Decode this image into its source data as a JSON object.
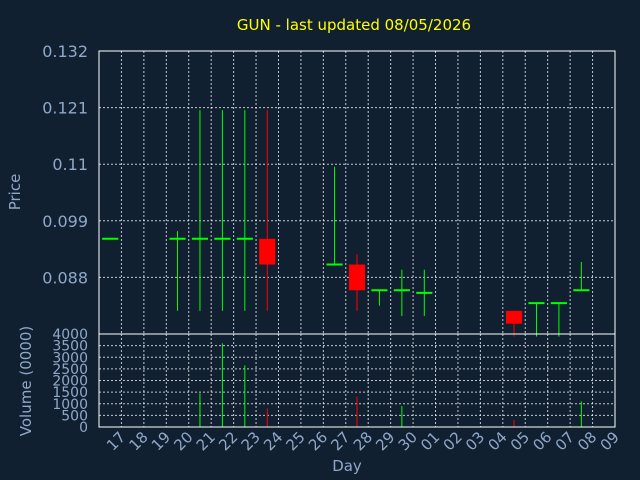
{
  "chart_data": {
    "type": "candlestick",
    "title": "GUN - last updated 08/05/2026",
    "ylabel_price": "Price",
    "ylabel_volume": "Volume (0000)",
    "xlabel": "Day",
    "price_ylim": [
      0.077,
      0.132
    ],
    "price_ticks": [
      "0.132",
      "0.121",
      "0.11",
      "0.099",
      "0.088"
    ],
    "volume_ylim": [
      0,
      4000
    ],
    "volume_ticks": [
      "4000",
      "3500",
      "3000",
      "2500",
      "2000",
      "1500",
      "1000",
      "500",
      "0"
    ],
    "x_ticks": [
      "17",
      "18",
      "19",
      "20",
      "21",
      "22",
      "23",
      "24",
      "25",
      "26",
      "27",
      "28",
      "29",
      "30",
      "01",
      "02",
      "03",
      "04",
      "05",
      "06",
      "07",
      "08",
      "09"
    ],
    "grid": true,
    "colors": {
      "up": "#00ff00",
      "down": "#ff0000",
      "background": "#112031",
      "title": "#ffff00",
      "text": "#8fa8c8"
    },
    "candles": [
      {
        "day": "17",
        "open": 0.0955,
        "high": 0.0955,
        "low": 0.0955,
        "close": 0.0955,
        "volume": 0
      },
      {
        "day": "20",
        "open": 0.0955,
        "high": 0.097,
        "low": 0.0815,
        "close": 0.0955,
        "volume": 0
      },
      {
        "day": "21",
        "open": 0.0955,
        "high": 0.1205,
        "low": 0.0815,
        "close": 0.0955,
        "volume": 1450
      },
      {
        "day": "22",
        "open": 0.0955,
        "high": 0.1205,
        "low": 0.0815,
        "close": 0.0955,
        "volume": 3600
      },
      {
        "day": "23",
        "open": 0.0955,
        "high": 0.1205,
        "low": 0.0815,
        "close": 0.0955,
        "volume": 2650
      },
      {
        "day": "24",
        "open": 0.0955,
        "high": 0.1205,
        "low": 0.0815,
        "close": 0.0905,
        "volume": 800
      },
      {
        "day": "27",
        "open": 0.0905,
        "high": 0.1095,
        "low": 0.0905,
        "close": 0.0905,
        "volume": 0
      },
      {
        "day": "28",
        "open": 0.0905,
        "high": 0.0925,
        "low": 0.0815,
        "close": 0.0855,
        "volume": 1300
      },
      {
        "day": "29",
        "open": 0.0855,
        "high": 0.0855,
        "low": 0.0825,
        "close": 0.0855,
        "volume": 0
      },
      {
        "day": "30",
        "open": 0.0855,
        "high": 0.0895,
        "low": 0.0805,
        "close": 0.0855,
        "volume": 900
      },
      {
        "day": "01",
        "open": 0.085,
        "high": 0.0895,
        "low": 0.0805,
        "close": 0.085,
        "volume": 0
      },
      {
        "day": "05",
        "open": 0.0815,
        "high": 0.0815,
        "low": 0.0765,
        "close": 0.079,
        "volume": 300
      },
      {
        "day": "06",
        "open": 0.083,
        "high": 0.083,
        "low": 0.0765,
        "close": 0.083,
        "volume": 0
      },
      {
        "day": "07",
        "open": 0.083,
        "high": 0.083,
        "low": 0.0765,
        "close": 0.083,
        "volume": 0
      },
      {
        "day": "08",
        "open": 0.0855,
        "high": 0.091,
        "low": 0.0855,
        "close": 0.0855,
        "volume": 1100
      }
    ]
  }
}
